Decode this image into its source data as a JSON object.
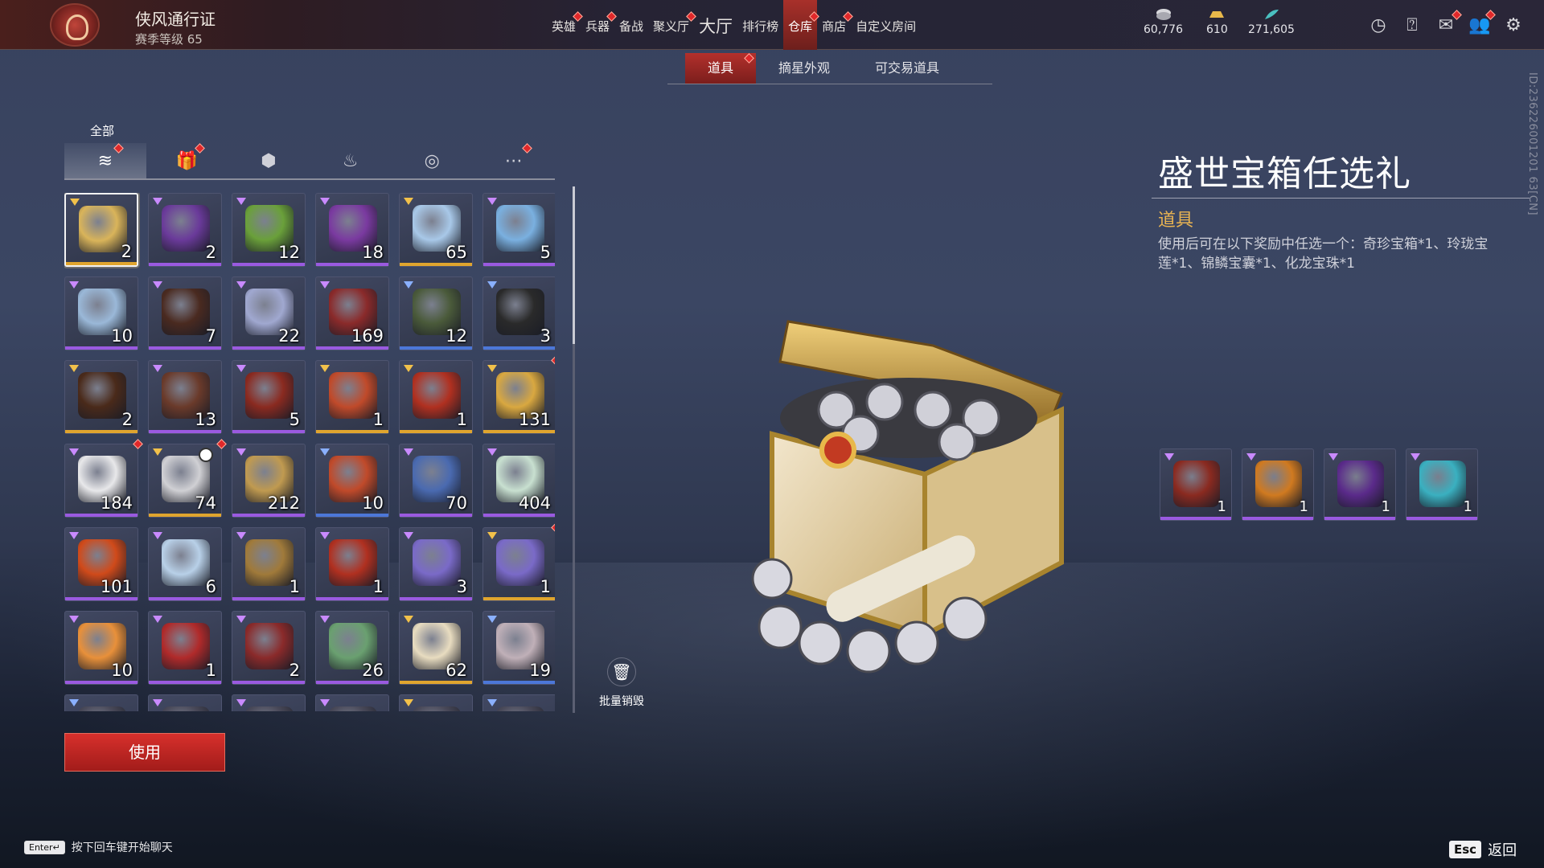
{
  "header": {
    "pass_title": "侠风通行证",
    "pass_level": "赛季等级 65",
    "nav": [
      {
        "label": "英雄",
        "dot": true
      },
      {
        "label": "兵器",
        "dot": true
      },
      {
        "label": "备战",
        "dot": false
      },
      {
        "label": "聚义厅",
        "dot": true
      },
      {
        "label": "大厅",
        "dot": false,
        "big": true
      },
      {
        "label": "排行榜",
        "dot": false
      },
      {
        "label": "仓库",
        "dot": true,
        "active": true
      },
      {
        "label": "商店",
        "dot": true
      },
      {
        "label": "自定义房间",
        "dot": false
      }
    ],
    "currencies": [
      {
        "icon": "coin-stack-icon",
        "value": "60,776"
      },
      {
        "icon": "gold-ingot-icon",
        "value": "610"
      },
      {
        "icon": "jade-feather-icon",
        "value": "271,605"
      }
    ],
    "icons": [
      "timer-icon",
      "help-icon",
      "mail-icon",
      "friends-icon",
      "settings-icon"
    ]
  },
  "subtabs": [
    {
      "label": "道具",
      "active": true,
      "dot": true
    },
    {
      "label": "摘星外观",
      "active": false,
      "dot": false
    },
    {
      "label": "可交易道具",
      "active": false,
      "dot": false
    }
  ],
  "category": {
    "label": "全部",
    "tabs": [
      {
        "icon": "layers-icon",
        "active": true,
        "dot": true
      },
      {
        "icon": "gift-icon",
        "active": false,
        "dot": true
      },
      {
        "icon": "badge-icon",
        "active": false,
        "dot": false
      },
      {
        "icon": "flame-icon",
        "active": false,
        "dot": false
      },
      {
        "icon": "swirl-icon",
        "active": false,
        "dot": false
      },
      {
        "icon": "more-icon",
        "active": false,
        "dot": true
      }
    ]
  },
  "inventory": {
    "items": [
      {
        "count": "2",
        "rarity": "gold",
        "color": "#d9b45a",
        "selected": true
      },
      {
        "count": "2",
        "rarity": "purple",
        "color": "#6a3a9a"
      },
      {
        "count": "12",
        "rarity": "purple",
        "color": "#6aa03a"
      },
      {
        "count": "18",
        "rarity": "purple",
        "color": "#7a3aa0"
      },
      {
        "count": "65",
        "rarity": "gold",
        "color": "#a8c8e8"
      },
      {
        "count": "5",
        "rarity": "purple",
        "color": "#7ab0e0"
      },
      {
        "count": "10",
        "rarity": "purple",
        "color": "#9ab8d8"
      },
      {
        "count": "7",
        "rarity": "purple",
        "color": "#4a2a20"
      },
      {
        "count": "22",
        "rarity": "purple",
        "color": "#a0a8d0"
      },
      {
        "count": "169",
        "rarity": "purple",
        "color": "#8a2a2a"
      },
      {
        "count": "12",
        "rarity": "blue",
        "color": "#4a5a3a"
      },
      {
        "count": "3",
        "rarity": "blue",
        "color": "#2a2a2a"
      },
      {
        "count": "2",
        "rarity": "gold",
        "color": "#4a2a1a"
      },
      {
        "count": "13",
        "rarity": "purple",
        "color": "#6a3a2a"
      },
      {
        "count": "5",
        "rarity": "purple",
        "color": "#8a2a20"
      },
      {
        "count": "1",
        "rarity": "gold",
        "color": "#c04a2a"
      },
      {
        "count": "1",
        "rarity": "gold",
        "color": "#b03020"
      },
      {
        "count": "131",
        "rarity": "gold",
        "color": "#d9a840",
        "dot": true
      },
      {
        "count": "184",
        "rarity": "purple",
        "color": "#e8e8ea",
        "dot": true
      },
      {
        "count": "74",
        "rarity": "gold",
        "color": "#d0d0d4",
        "dot": true,
        "clock": true
      },
      {
        "count": "212",
        "rarity": "purple",
        "color": "#c09a50"
      },
      {
        "count": "10",
        "rarity": "blue",
        "color": "#c04a2a"
      },
      {
        "count": "70",
        "rarity": "purple",
        "color": "#4a6ab0"
      },
      {
        "count": "404",
        "rarity": "purple",
        "color": "#c8e0d0"
      },
      {
        "count": "101",
        "rarity": "purple",
        "color": "#d04a1a"
      },
      {
        "count": "6",
        "rarity": "purple",
        "color": "#b8d0e8"
      },
      {
        "count": "1",
        "rarity": "purple",
        "color": "#a07a3a"
      },
      {
        "count": "1",
        "rarity": "purple",
        "color": "#b03020"
      },
      {
        "count": "3",
        "rarity": "purple",
        "color": "#7a6ac8"
      },
      {
        "count": "1",
        "rarity": "gold",
        "color": "#7a6ac8",
        "dot": true
      },
      {
        "count": "10",
        "rarity": "purple",
        "color": "#e8903a"
      },
      {
        "count": "1",
        "rarity": "purple",
        "color": "#b02a2a"
      },
      {
        "count": "2",
        "rarity": "purple",
        "color": "#8a2a2a"
      },
      {
        "count": "26",
        "rarity": "purple",
        "color": "#6aa070"
      },
      {
        "count": "62",
        "rarity": "gold",
        "color": "#e8dcc0"
      },
      {
        "count": "19",
        "rarity": "blue",
        "color": "#c0b0b8"
      },
      {
        "count": "",
        "rarity": "blue",
        "color": "#4a4a5a"
      },
      {
        "count": "",
        "rarity": "purple",
        "color": "#4a4a5a"
      },
      {
        "count": "",
        "rarity": "purple",
        "color": "#4a4a5a"
      },
      {
        "count": "",
        "rarity": "purple",
        "color": "#4a4a5a"
      },
      {
        "count": "",
        "rarity": "gold",
        "color": "#4a4a5a"
      },
      {
        "count": "",
        "rarity": "blue",
        "color": "#4a4a5a"
      }
    ]
  },
  "actions": {
    "use_label": "使用",
    "destroy_label": "批量销毁",
    "chat_key": "Enter↵",
    "chat_hint": "按下回车键开始聊天",
    "esc_key": "Esc",
    "back_label": "返回"
  },
  "detail": {
    "title": "盛世宝箱任选礼",
    "type": "道具",
    "description": "使用后可在以下奖励中任选一个：奇珍宝箱*1、玲珑宝莲*1、锦鳞宝囊*1、化龙宝珠*1",
    "rewards": [
      {
        "count": "1",
        "color": "#8a2a20"
      },
      {
        "count": "1",
        "color": "#d07a20"
      },
      {
        "count": "1",
        "color": "#5a2a8a"
      },
      {
        "count": "1",
        "color": "#3ab0c0"
      }
    ]
  },
  "side_id": "ID:236226001201 63[CN]",
  "colors": {
    "accent": "#b3302c",
    "gold": "#e9b452",
    "purple": "#9a5ae0",
    "blue": "#4c77d8"
  }
}
